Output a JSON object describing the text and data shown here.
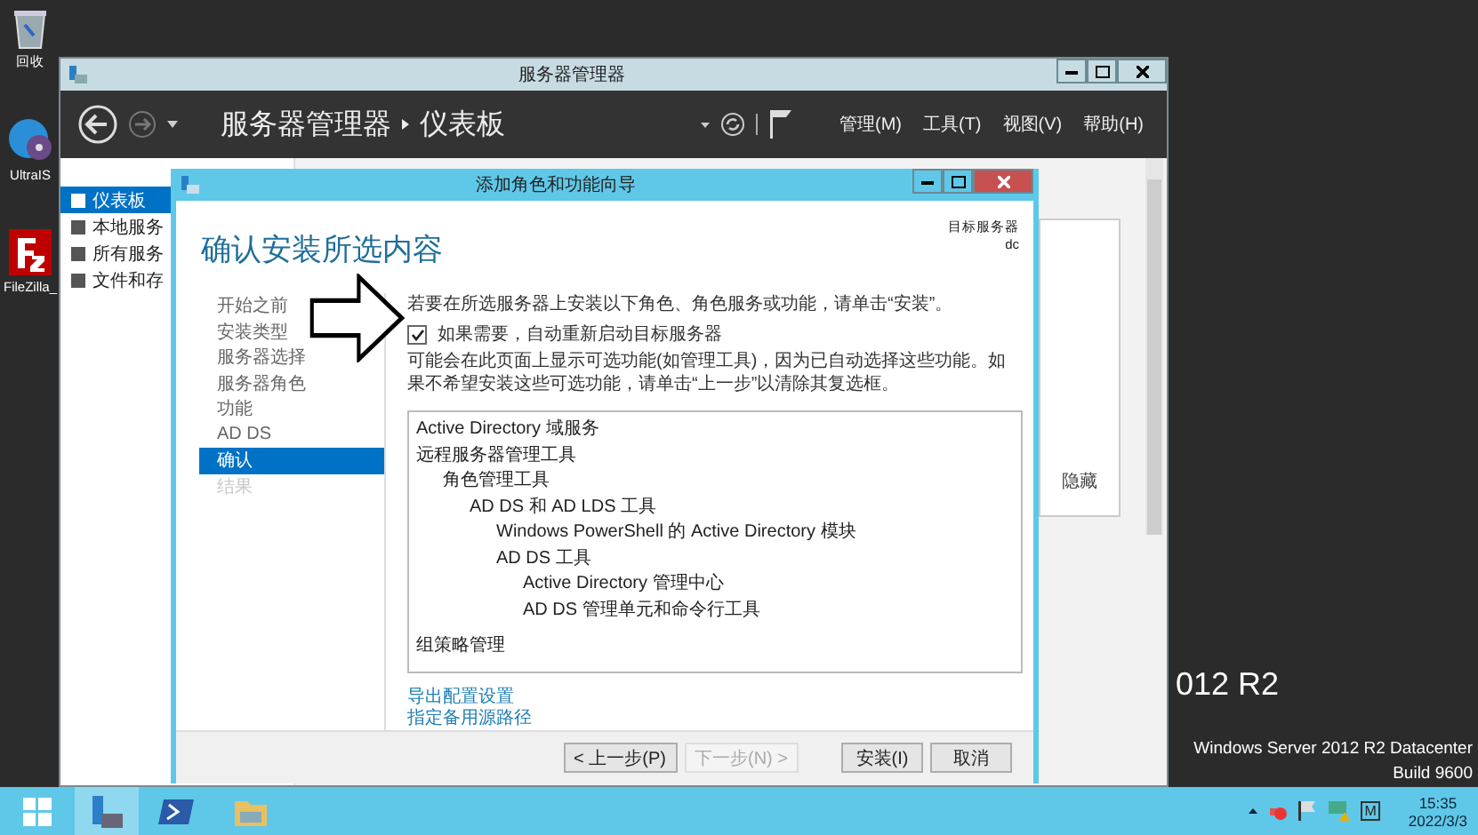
{
  "desktop_icons": [
    {
      "label": "回收",
      "kind": "bin"
    },
    {
      "label": "UltraIS",
      "kind": "disc"
    },
    {
      "label": "FileZilla_",
      "kind": "fz"
    }
  ],
  "server_manager": {
    "title": "服务器管理器",
    "breadcrumb": [
      "服务器管理器",
      "仪表板"
    ],
    "menu": [
      "管理(M)",
      "工具(T)",
      "视图(V)",
      "帮助(H)"
    ],
    "sidebar": [
      {
        "label": "仪表板",
        "selected": true
      },
      {
        "label": "本地服务",
        "selected": false
      },
      {
        "label": "所有服务",
        "selected": false
      },
      {
        "label": "文件和存",
        "selected": false
      }
    ],
    "panel_text": "隐藏"
  },
  "wizard": {
    "title": "添加角色和功能向导",
    "heading": "确认安装所选内容",
    "target_label": "目标服务器",
    "target_value": "dc",
    "nav": [
      {
        "label": "开始之前",
        "selected": false,
        "disabled": false
      },
      {
        "label": "安装类型",
        "selected": false,
        "disabled": false
      },
      {
        "label": "服务器选择",
        "selected": false,
        "disabled": false
      },
      {
        "label": "服务器角色",
        "selected": false,
        "disabled": false
      },
      {
        "label": "功能",
        "selected": false,
        "disabled": false
      },
      {
        "label": "AD DS",
        "selected": false,
        "disabled": false
      },
      {
        "label": "确认",
        "selected": true,
        "disabled": false
      },
      {
        "label": "结果",
        "selected": false,
        "disabled": true
      }
    ],
    "instruction": "若要在所选服务器上安装以下角色、角色服务或功能，请单击“安装”。",
    "restart": {
      "label": "如果需要，自动重新启动目标服务器",
      "checked": true
    },
    "note": "可能会在此页面上显示可选功能(如管理工具)，因为已自动选择这些功能。如果不希望安装这些可选功能，请单击“上一步”以清除其复选框。",
    "items": [
      {
        "label": "Active Directory 域服务"
      },
      {
        "label": "远程服务器管理工具",
        "children": [
          {
            "label": "角色管理工具",
            "children": [
              {
                "label": "AD DS 和 AD LDS 工具",
                "children": [
                  {
                    "label": "Windows PowerShell 的 Active Directory 模块"
                  },
                  {
                    "label": "AD DS 工具",
                    "children": [
                      {
                        "label": "Active Directory 管理中心"
                      },
                      {
                        "label": "AD DS 管理单元和命令行工具"
                      }
                    ]
                  }
                ]
              }
            ]
          }
        ]
      },
      {
        "label": "组策略管理"
      }
    ],
    "links": [
      "导出配置设置",
      "指定备用源路径"
    ],
    "buttons": [
      {
        "label": "< 上一步(P)",
        "disabled": false
      },
      {
        "label": "下一步(N) >",
        "disabled": true
      },
      {
        "label": "安装(I)",
        "disabled": false
      },
      {
        "label": "取消",
        "disabled": false
      }
    ]
  },
  "desktop_text": {
    "version": "012 R2",
    "edition": "Windows Server 2012 R2 Datacenter",
    "build": "Build 9600"
  },
  "taskbar": {
    "time": "15:35",
    "date": "2022/3/3",
    "tray_letter": "M"
  }
}
